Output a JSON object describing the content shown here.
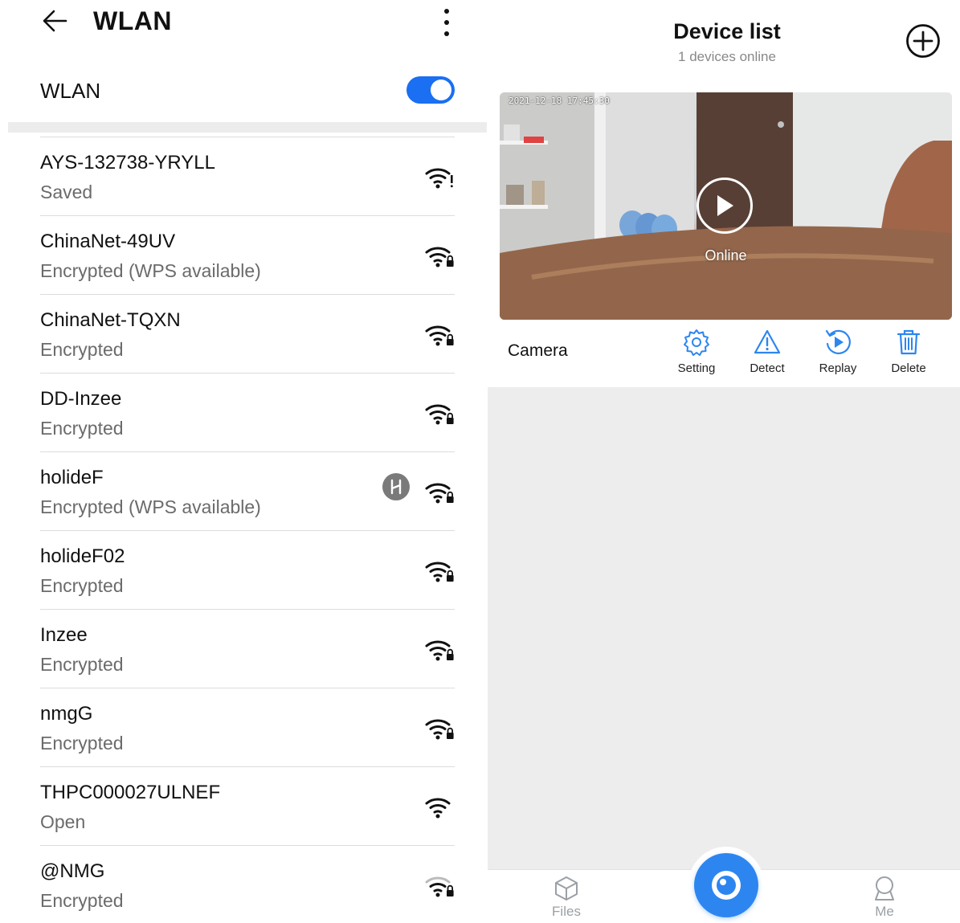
{
  "wlan": {
    "title": "WLAN",
    "toggle_label": "WLAN",
    "toggle_on": true,
    "accent_color": "#1a6ff2",
    "networks": [
      {
        "name": "AYS-132738-YRYLL",
        "status": "Saved",
        "icon": "wifi-alert-icon"
      },
      {
        "name": "ChinaNet-49UV",
        "status": "Encrypted (WPS available)",
        "icon": "wifi-lock-icon"
      },
      {
        "name": "ChinaNet-TQXN",
        "status": "Encrypted",
        "icon": "wifi-lock-icon"
      },
      {
        "name": "DD-Inzee",
        "status": "Encrypted",
        "icon": "wifi-lock-icon"
      },
      {
        "name": "holideF",
        "status": "Encrypted (WPS available)",
        "icon": "wifi-lock-icon",
        "badge": "hilink-icon"
      },
      {
        "name": "holideF02",
        "status": "Encrypted",
        "icon": "wifi-lock-icon"
      },
      {
        "name": "Inzee",
        "status": "Encrypted",
        "icon": "wifi-lock-icon"
      },
      {
        "name": "nmgG",
        "status": "Encrypted",
        "icon": "wifi-lock-icon"
      },
      {
        "name": "THPC000027ULNEF",
        "status": "Open",
        "icon": "wifi-icon"
      },
      {
        "name": "@NMG",
        "status": "Encrypted",
        "icon": "wifi-lock-weak-icon"
      }
    ]
  },
  "devices": {
    "title": "Device list",
    "subtitle": "1 devices online",
    "camera": {
      "timestamp": "2021-12-18 17:45:30",
      "status": "Online",
      "name": "Camera",
      "actions": [
        {
          "label": "Setting",
          "icon": "gear-icon"
        },
        {
          "label": "Detect",
          "icon": "warning-icon"
        },
        {
          "label": "Replay",
          "icon": "replay-icon"
        },
        {
          "label": "Delete",
          "icon": "trash-icon"
        }
      ]
    },
    "tabs": [
      {
        "label": "Files",
        "icon": "box-icon"
      },
      {
        "label": "",
        "icon": "eye-icon"
      },
      {
        "label": "Me",
        "icon": "user-icon"
      }
    ],
    "accent_color": "#2d86f0"
  }
}
